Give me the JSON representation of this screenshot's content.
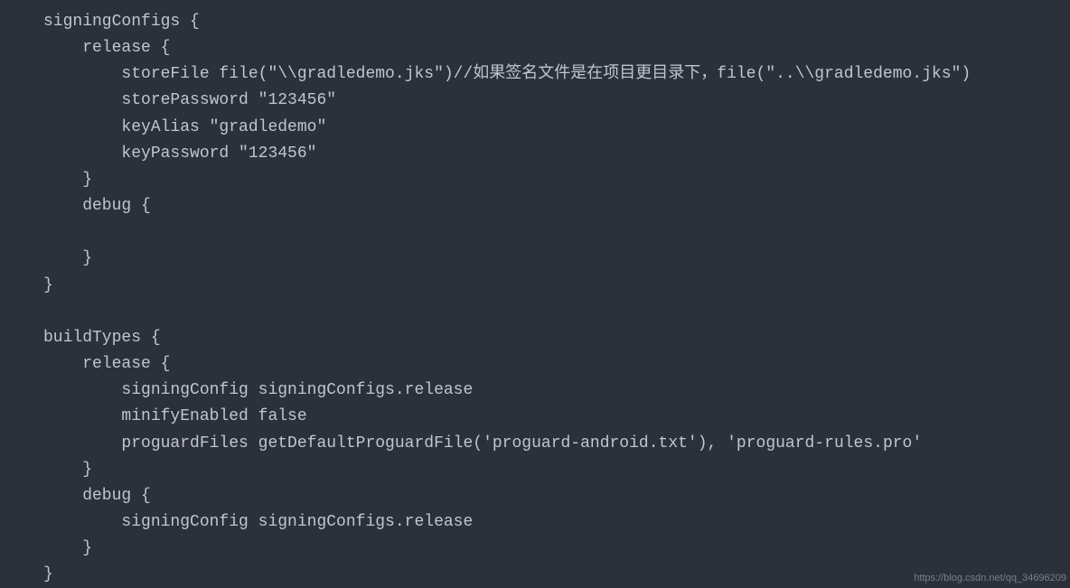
{
  "code": {
    "lines": [
      "signingConfigs {",
      "    release {",
      "        storeFile file(\"\\\\gradledemo.jks\")//如果签名文件是在项目更目录下，file(\"..\\\\gradledemo.jks\")",
      "        storePassword \"123456\"",
      "        keyAlias \"gradledemo\"",
      "        keyPassword \"123456\"",
      "    }",
      "    debug {",
      "",
      "    }",
      "}",
      "",
      "buildTypes {",
      "    release {",
      "        signingConfig signingConfigs.release",
      "        minifyEnabled false",
      "        proguardFiles getDefaultProguardFile('proguard-android.txt'), 'proguard-rules.pro'",
      "    }",
      "    debug {",
      "        signingConfig signingConfigs.release",
      "    }",
      "}"
    ]
  },
  "watermark": "https://blog.csdn.net/qq_34696209"
}
